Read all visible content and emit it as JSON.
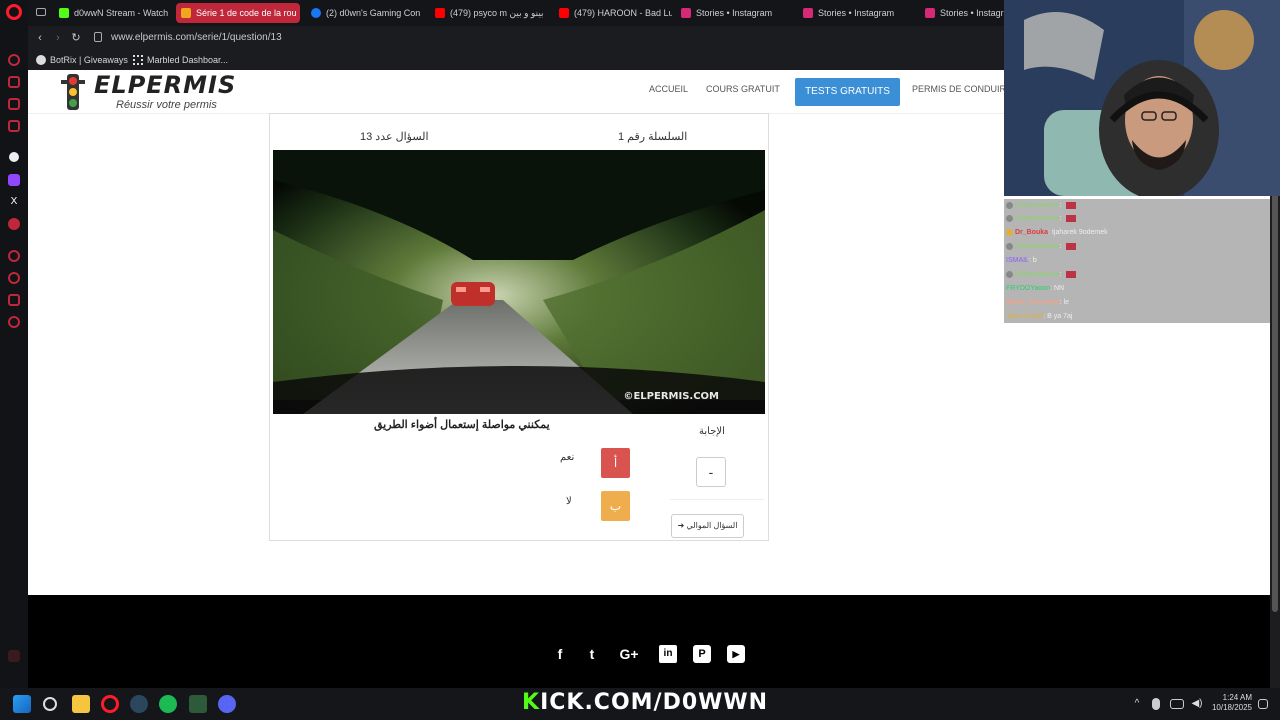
{
  "browser": {
    "tabs": [
      {
        "label": "d0wwN Stream - Watch",
        "color": "#53fc18"
      },
      {
        "label": "Série 1 de code de la rou",
        "color": "#f2a51f",
        "active": true
      },
      {
        "label": "(2) d0wn's Gaming Con",
        "color": "#1877f2"
      },
      {
        "label": "(479) psyco m بينو و بين",
        "color": "#ff0000"
      },
      {
        "label": "(479) HAROON - Bad Lu",
        "color": "#ff0000"
      },
      {
        "label": "Stories • Instagram",
        "color": "#d62976"
      },
      {
        "label": "Stories • Instagram",
        "color": "#d62976"
      },
      {
        "label": "Stories • Instagra",
        "color": "#d62976"
      }
    ],
    "url": "www.elpermis.com/serie/1/question/13",
    "bookmarks": [
      "BotRix | Giveaways",
      "Marbled Dashboar..."
    ]
  },
  "site": {
    "logo": "ELPERMIS",
    "tagline": "Réussir votre permis",
    "nav": [
      "ACCUEIL",
      "COURS GRATUIT",
      "TESTS GRATUITS",
      "PERMIS DE CONDUIRE"
    ]
  },
  "quiz": {
    "question_number": "السؤال عدد 13",
    "series": "السلسلة رقم 1",
    "watermark": "©ELPERMIS.COM",
    "question_text": "يمكنني مواصلة إستعمال أضواء الطريق",
    "answer_label": "الإجابة",
    "answer_value": "-",
    "options": [
      {
        "key": "أ",
        "label": "نعم",
        "color": "#d9534f"
      },
      {
        "key": "ب",
        "label": "لا",
        "color": "#f0ad4e"
      }
    ],
    "next_button": "السؤال الموالي"
  },
  "footer": {
    "social_icons": [
      "facebook-icon",
      "twitter-icon",
      "google-plus-icon",
      "linkedin-icon",
      "pinterest-icon",
      "youtube-icon"
    ],
    "social_glyphs": [
      "f",
      "t",
      "G+",
      "in",
      "P",
      "▶"
    ]
  },
  "chat": [
    {
      "user": "chikampawlou",
      "msg": "",
      "color": "#8bd36a",
      "emote": true
    },
    {
      "user": "chikampawlou",
      "msg": "",
      "color": "#8bd36a",
      "emote": true
    },
    {
      "user": "Dr_Bouka",
      "msg": "tjaharek 9odemek",
      "color": "#e03c3c",
      "emote": false
    },
    {
      "user": "chikampawlou",
      "msg": "",
      "color": "#8bd36a",
      "emote": true
    },
    {
      "user": "ISMAIL",
      "msg": "b",
      "color": "#8a5cff",
      "emote": false
    },
    {
      "user": "chikampawlou",
      "msg": "",
      "color": "#8bd36a",
      "emote": true
    },
    {
      "user": "FRYDOYaoon",
      "msg": "NN",
      "color": "#2ecc71",
      "emote": false
    },
    {
      "user": "Alpha_Chernobyl",
      "msg": "le",
      "color": "#ff9e80",
      "emote": false
    },
    {
      "user": "YpaLm7aarl",
      "msg": "B ya 7aj",
      "color": "#e0b03a",
      "emote": false
    }
  ],
  "taskbar": {
    "banner_k": "K",
    "banner_rest": "ICK.COM/D0WWN",
    "time": "1:24 AM",
    "date": "10/18/2025"
  }
}
